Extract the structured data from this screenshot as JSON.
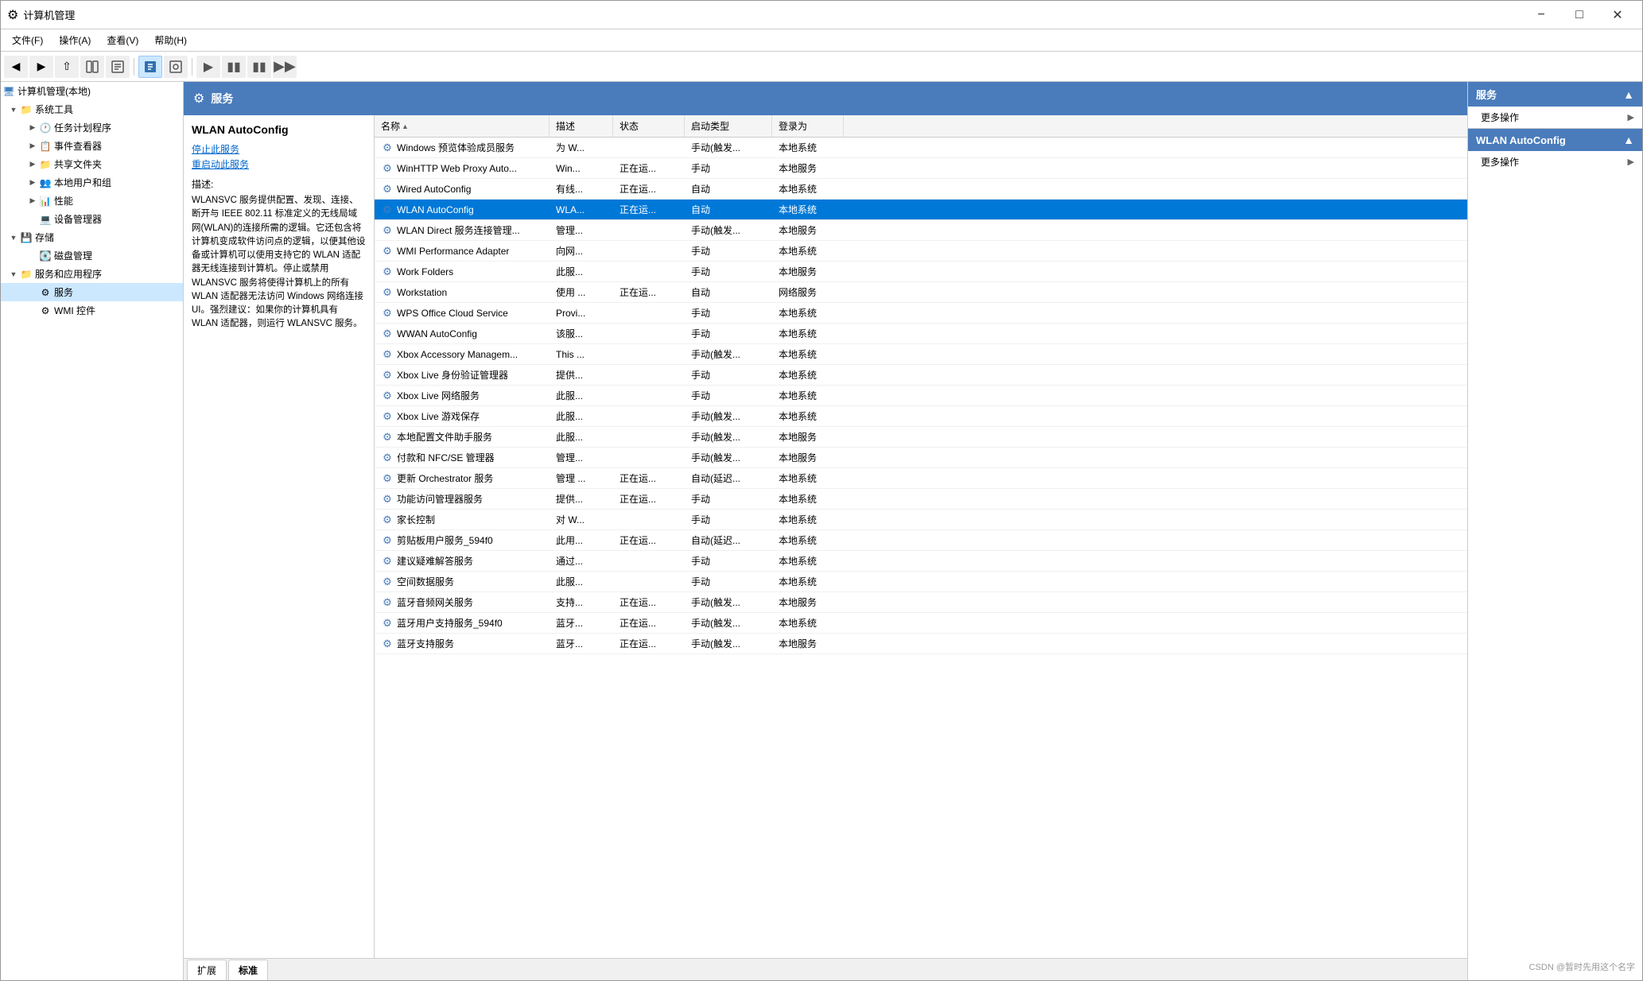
{
  "window": {
    "title": "计算机管理",
    "icon": "⚙"
  },
  "menu": {
    "items": [
      "文件(F)",
      "操作(A)",
      "查看(V)",
      "帮助(H)"
    ]
  },
  "header": {
    "title": "服务",
    "icon": "⚙"
  },
  "sidebar": {
    "root_label": "计算机管理(本地)",
    "items": [
      {
        "id": "system-tools",
        "label": "系统工具",
        "level": 1,
        "expanded": true,
        "icon": "folder"
      },
      {
        "id": "task-scheduler",
        "label": "任务计划程序",
        "level": 2,
        "expanded": false,
        "icon": "clock"
      },
      {
        "id": "event-viewer",
        "label": "事件查看器",
        "level": 2,
        "expanded": false,
        "icon": "log"
      },
      {
        "id": "shared-folders",
        "label": "共享文件夹",
        "level": 2,
        "expanded": false,
        "icon": "folder"
      },
      {
        "id": "local-users",
        "label": "本地用户和组",
        "level": 2,
        "expanded": false,
        "icon": "users"
      },
      {
        "id": "performance",
        "label": "性能",
        "level": 2,
        "expanded": false,
        "icon": "chart"
      },
      {
        "id": "device-manager",
        "label": "设备管理器",
        "level": 2,
        "expanded": false,
        "icon": "device"
      },
      {
        "id": "storage",
        "label": "存储",
        "level": 1,
        "expanded": true,
        "icon": "disk"
      },
      {
        "id": "disk-management",
        "label": "磁盘管理",
        "level": 2,
        "expanded": false,
        "icon": "disk"
      },
      {
        "id": "services-apps",
        "label": "服务和应用程序",
        "level": 1,
        "expanded": true,
        "icon": "folder"
      },
      {
        "id": "services",
        "label": "服务",
        "level": 2,
        "expanded": false,
        "icon": "gear",
        "selected": true
      },
      {
        "id": "wmi-control",
        "label": "WMI 控件",
        "level": 2,
        "expanded": false,
        "icon": "gear"
      }
    ]
  },
  "service_detail": {
    "name": "WLAN AutoConfig",
    "stop_link": "停止此服务",
    "restart_link": "重启动此服务",
    "desc_label": "描述:",
    "description": "WLANSVC 服务提供配置、发现、连接、断开与 IEEE 802.11 标准定义的无线局域网(WLAN)的连接所需的逻辑。它还包含将计算机变成软件访问点的逻辑，以便其他设备或计算机可以使用支持它的 WLAN 适配器无线连接到计算机。停止或禁用 WLANSVC 服务将使得计算机上的所有 WLAN 适配器无法访问 Windows 网络连接 UI。强烈建议：如果你的计算机具有 WLAN 适配器，则运行 WLANSVC 服务。"
  },
  "columns": {
    "name": "名称",
    "description": "描述",
    "status": "状态",
    "startup_type": "启动类型",
    "logon_as": "登录为"
  },
  "services": [
    {
      "name": "Windows 预览体验成员服务",
      "desc": "为 W...",
      "status": "",
      "startup": "手动(触发...",
      "logon": "本地系统"
    },
    {
      "name": "WinHTTP Web Proxy Auto...",
      "desc": "Win...",
      "status": "正在运...",
      "startup": "手动",
      "logon": "本地服务"
    },
    {
      "name": "Wired AutoConfig",
      "desc": "有线...",
      "status": "正在运...",
      "startup": "自动",
      "logon": "本地系统"
    },
    {
      "name": "WLAN AutoConfig",
      "desc": "WLA...",
      "status": "正在运...",
      "startup": "自动",
      "logon": "本地系统",
      "selected": true
    },
    {
      "name": "WLAN Direct 服务连接管理...",
      "desc": "管理...",
      "status": "",
      "startup": "手动(触发...",
      "logon": "本地服务"
    },
    {
      "name": "WMI Performance Adapter",
      "desc": "向网...",
      "status": "",
      "startup": "手动",
      "logon": "本地系统"
    },
    {
      "name": "Work Folders",
      "desc": "此服...",
      "status": "",
      "startup": "手动",
      "logon": "本地服务"
    },
    {
      "name": "Workstation",
      "desc": "使用 ...",
      "status": "正在运...",
      "startup": "自动",
      "logon": "网络服务"
    },
    {
      "name": "WPS Office Cloud Service",
      "desc": "Provi...",
      "status": "",
      "startup": "手动",
      "logon": "本地系统"
    },
    {
      "name": "WWAN AutoConfig",
      "desc": "该服...",
      "status": "",
      "startup": "手动",
      "logon": "本地系统"
    },
    {
      "name": "Xbox Accessory Managem...",
      "desc": "This ...",
      "status": "",
      "startup": "手动(触发...",
      "logon": "本地系统"
    },
    {
      "name": "Xbox Live 身份验证管理器",
      "desc": "提供...",
      "status": "",
      "startup": "手动",
      "logon": "本地系统"
    },
    {
      "name": "Xbox Live 网络服务",
      "desc": "此服...",
      "status": "",
      "startup": "手动",
      "logon": "本地系统"
    },
    {
      "name": "Xbox Live 游戏保存",
      "desc": "此服...",
      "status": "",
      "startup": "手动(触发...",
      "logon": "本地系统"
    },
    {
      "name": "本地配置文件助手服务",
      "desc": "此服...",
      "status": "",
      "startup": "手动(触发...",
      "logon": "本地服务"
    },
    {
      "name": "付款和 NFC/SE 管理器",
      "desc": "管理...",
      "status": "",
      "startup": "手动(触发...",
      "logon": "本地服务"
    },
    {
      "name": "更新 Orchestrator 服务",
      "desc": "管理 ...",
      "status": "正在运...",
      "startup": "自动(延迟...",
      "logon": "本地系统"
    },
    {
      "name": "功能访问管理器服务",
      "desc": "提供...",
      "status": "正在运...",
      "startup": "手动",
      "logon": "本地系统"
    },
    {
      "name": "家长控制",
      "desc": "对 W...",
      "status": "",
      "startup": "手动",
      "logon": "本地系统"
    },
    {
      "name": "剪贴板用户服务_594f0",
      "desc": "此用...",
      "status": "正在运...",
      "startup": "自动(延迟...",
      "logon": "本地系统"
    },
    {
      "name": "建议疑难解答服务",
      "desc": "通过...",
      "status": "",
      "startup": "手动",
      "logon": "本地系统"
    },
    {
      "name": "空间数据服务",
      "desc": "此服...",
      "status": "",
      "startup": "手动",
      "logon": "本地系统"
    },
    {
      "name": "蓝牙音频网关服务",
      "desc": "支持...",
      "status": "正在运...",
      "startup": "手动(触发...",
      "logon": "本地服务"
    },
    {
      "name": "蓝牙用户支持服务_594f0",
      "desc": "蓝牙...",
      "status": "正在运...",
      "startup": "手动(触发...",
      "logon": "本地系统"
    },
    {
      "name": "蓝牙支持服务",
      "desc": "蓝牙...",
      "status": "正在运...",
      "startup": "手动(触发...",
      "logon": "本地服务"
    }
  ],
  "right_panel": {
    "section1": {
      "title": "服务",
      "actions": [
        "更多操作"
      ]
    },
    "section2": {
      "title": "WLAN AutoConfig",
      "actions": [
        "更多操作"
      ]
    }
  },
  "bottom_tabs": [
    "扩展",
    "标准"
  ],
  "active_tab": "标准",
  "watermark": "CSDN @暂时先用这个名字"
}
